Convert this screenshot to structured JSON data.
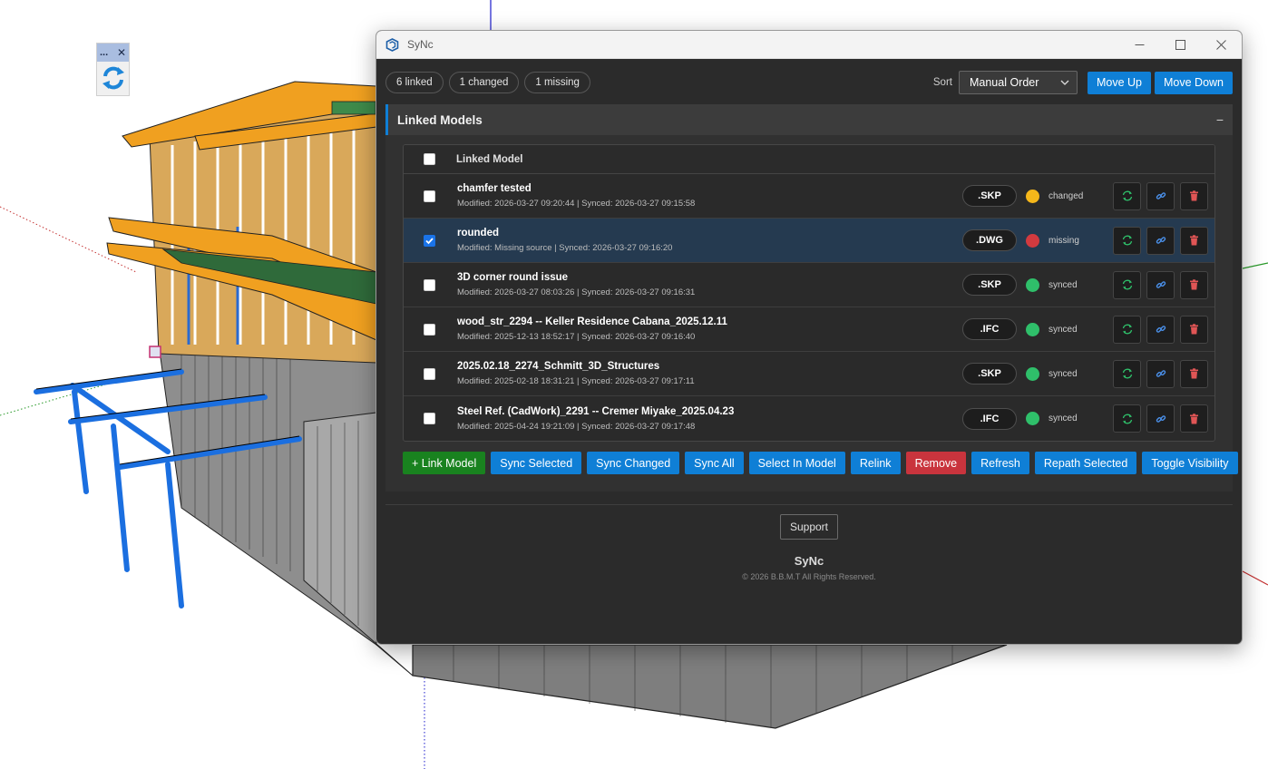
{
  "window": {
    "title": "SyNc",
    "app_icon": "sketchup-icon",
    "controls": [
      "minimize-icon",
      "maximize-icon",
      "close-icon"
    ]
  },
  "summary": {
    "linked": "6 linked",
    "changed": "1 changed",
    "missing": "1 missing"
  },
  "sort": {
    "label": "Sort",
    "selected": "Manual Order",
    "move_up": "Move Up",
    "move_down": "Move Down"
  },
  "section": {
    "title": "Linked Models",
    "collapse": "−"
  },
  "table": {
    "header": "Linked Model",
    "rows": [
      {
        "name": "chamfer tested",
        "meta": "Modified: 2026-03-27 09:20:44 | Synced: 2026-03-27 09:15:58",
        "ext": ".SKP",
        "status": "changed",
        "status_color": "#f5b71a",
        "checked": false
      },
      {
        "name": "rounded",
        "meta": "Modified: Missing source | Synced: 2026-03-27 09:16:20",
        "ext": ".DWG",
        "status": "missing",
        "status_color": "#d23a3f",
        "checked": true
      },
      {
        "name": "3D corner round issue",
        "meta": "Modified: 2026-03-27 08:03:26 | Synced: 2026-03-27 09:16:31",
        "ext": ".SKP",
        "status": "synced",
        "status_color": "#2fbf6a",
        "checked": false
      },
      {
        "name": "wood_str_2294 -- Keller Residence Cabana_2025.12.11",
        "meta": "Modified: 2025-12-13 18:52:17 | Synced: 2026-03-27 09:16:40",
        "ext": ".IFC",
        "status": "synced",
        "status_color": "#2fbf6a",
        "checked": false
      },
      {
        "name": "2025.02.18_2274_Schmitt_3D_Structures",
        "meta": "Modified: 2025-02-18 18:31:21 | Synced: 2026-03-27 09:17:11",
        "ext": ".SKP",
        "status": "synced",
        "status_color": "#2fbf6a",
        "checked": false
      },
      {
        "name": "Steel Ref. (CadWork)_2291 -- Cremer Miyake_2025.04.23",
        "meta": "Modified: 2025-04-24 19:21:09 | Synced: 2026-03-27 09:17:48",
        "ext": ".IFC",
        "status": "synced",
        "status_color": "#2fbf6a",
        "checked": false
      }
    ]
  },
  "actions": {
    "link_model": "+ Link Model",
    "sync_selected": "Sync Selected",
    "sync_changed": "Sync Changed",
    "sync_all": "Sync All",
    "select_in_model": "Select In Model",
    "relink": "Relink",
    "remove": "Remove",
    "refresh": "Refresh",
    "repath_selected": "Repath Selected",
    "toggle_visibility": "Toggle Visibility"
  },
  "footer": {
    "support": "Support",
    "brand": "SyNc",
    "copyright": "© 2026 B.B.M.T All Rights Reserved."
  },
  "mini_toolbar": {
    "dots": "...",
    "close": "✕",
    "tool_icon": "sync-arrows-icon"
  },
  "colors": {
    "accent": "#0f7fd6",
    "success": "#19821f",
    "danger": "#c9343d",
    "changed": "#f5b71a",
    "missing": "#d23a3f",
    "synced": "#2fbf6a"
  }
}
